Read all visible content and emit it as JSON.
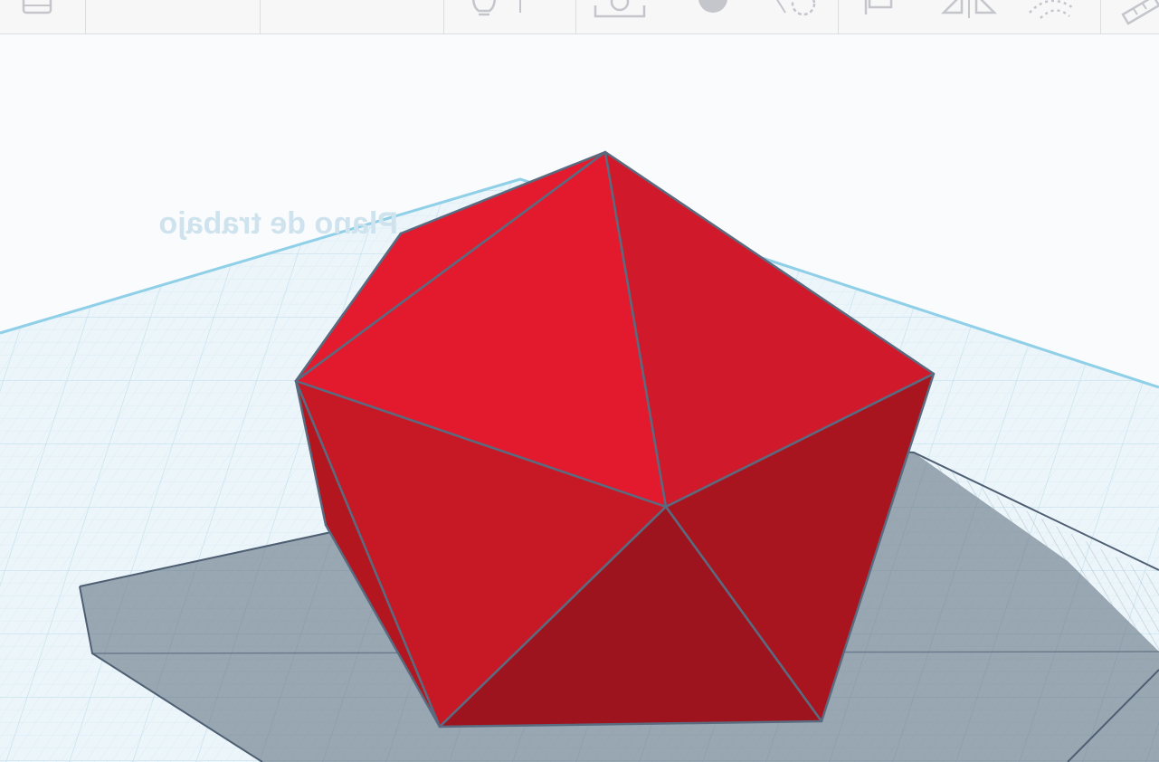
{
  "toolbar": {
    "partial_text": "‘’ ’ ’",
    "tools": [
      {
        "name": "notes-icon"
      },
      {
        "name": "light-bulb-icon"
      },
      {
        "name": "workplane-icon"
      },
      {
        "name": "solid-shape-icon"
      },
      {
        "name": "hole-shape-icon"
      },
      {
        "name": "align-icon"
      },
      {
        "name": "mirror-icon"
      },
      {
        "name": "group-icon"
      },
      {
        "name": "ruler-icon"
      }
    ]
  },
  "workplane": {
    "label": "Plano de trabajo",
    "grid_color": "#cfe6f1",
    "edge_color": "#7ec8e3"
  },
  "shape": {
    "type": "icosahedron",
    "color": "#e0192d",
    "edge_color": "#5a6b80",
    "selection_box_color": "#4f5f73"
  }
}
